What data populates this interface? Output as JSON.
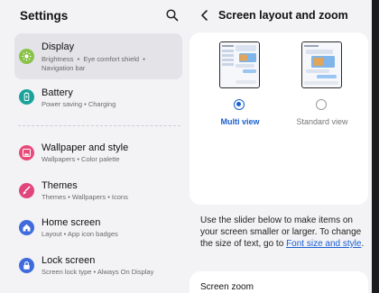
{
  "settings": {
    "title": "Settings",
    "items": [
      {
        "label": "Display",
        "sub": "Brightness  •  Eye comfort shield  •\nNavigation bar",
        "color": "#8bc34a",
        "icon": "sun-icon"
      },
      {
        "label": "Battery",
        "sub": "Power saving  •  Charging",
        "color": "#1aa39a",
        "icon": "battery-icon"
      },
      {
        "label": "Wallpaper and style",
        "sub": "Wallpapers  •  Color palette",
        "color": "#e84a79",
        "icon": "image-icon"
      },
      {
        "label": "Themes",
        "sub": "Themes  •  Wallpapers  •  Icons",
        "color": "#e0457c",
        "icon": "brush-icon"
      },
      {
        "label": "Home screen",
        "sub": "Layout  •  App icon badges",
        "color": "#3f6bdc",
        "icon": "home-icon"
      },
      {
        "label": "Lock screen",
        "sub": "Screen lock type  •  Always On Display",
        "color": "#3f6bdc",
        "icon": "lock-icon"
      }
    ]
  },
  "detail": {
    "title": "Screen layout and zoom",
    "options": [
      {
        "label": "Multi view",
        "selected": true
      },
      {
        "label": "Standard view",
        "selected": false
      }
    ],
    "description": "Use the slider below to make items on your screen smaller or larger. To change the size of text, go to ",
    "link": "Font size and style",
    "description_end": ".",
    "zoom_label": "Screen zoom"
  },
  "colors": {
    "accent": "#1a5fcf",
    "selected_bg": "#e4e4e8",
    "page_bg": "#f3f3f6"
  }
}
